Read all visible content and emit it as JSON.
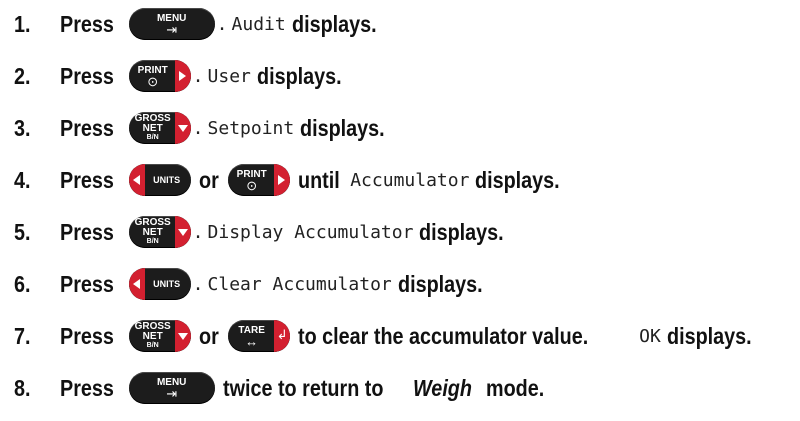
{
  "steps": [
    {
      "num": "1.",
      "press": "Press",
      "after_key": ".",
      "code": "Audit",
      "tail": "displays."
    },
    {
      "num": "2.",
      "press": "Press",
      "after_key": ".",
      "code": "User",
      "tail": "displays."
    },
    {
      "num": "3.",
      "press": "Press",
      "after_key": ".",
      "code": "Setpoint",
      "tail": "displays."
    },
    {
      "num": "4.",
      "press": "Press",
      "or": "or",
      "until": "until",
      "code": "Accumulator",
      "tail": "displays."
    },
    {
      "num": "5.",
      "press": "Press",
      "after_key": ".",
      "code": "Display Accumulator",
      "tail": "displays."
    },
    {
      "num": "6.",
      "press": "Press",
      "after_key": ".",
      "code": "Clear Accumulator",
      "tail": "displays."
    },
    {
      "num": "7.",
      "press": "Press",
      "or": "or",
      "middle": "to clear the accumulator value.",
      "code": "OK",
      "tail": "displays."
    },
    {
      "num": "8.",
      "press": "Press",
      "text_a": "twice to return to",
      "mode": "Weigh",
      "text_b": "mode."
    }
  ],
  "keys": {
    "menu": {
      "label": "MENU",
      "glyph": "⇥"
    },
    "print": {
      "label": "PRINT",
      "glyph": "⊙"
    },
    "gross": {
      "line1": "GROSS",
      "line2": "NET",
      "line3": "B/N"
    },
    "units": {
      "label": "UNITS"
    },
    "tare": {
      "label": "TARE",
      "glyph": "↔"
    }
  },
  "colors": {
    "key_body": "#1c1c1c",
    "key_accent": "#d32030",
    "text": "#111111"
  }
}
